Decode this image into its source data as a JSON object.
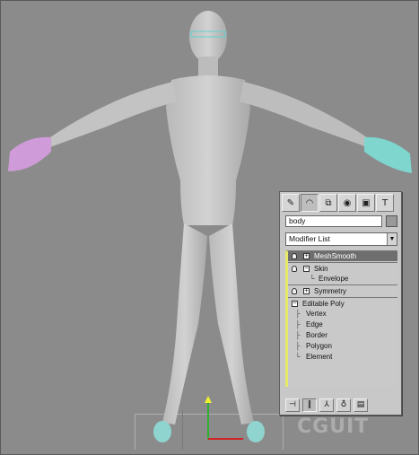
{
  "panel": {
    "tabs": [
      {
        "name": "create-tab",
        "glyph": "✎"
      },
      {
        "name": "modify-tab",
        "glyph": "◠"
      },
      {
        "name": "hierarchy-tab",
        "glyph": "⧉"
      },
      {
        "name": "motion-tab",
        "glyph": "◉"
      },
      {
        "name": "display-tab",
        "glyph": "▣"
      },
      {
        "name": "utilities-tab",
        "glyph": "T"
      }
    ],
    "object_name": "body",
    "modifier_list_label": "Modifier List",
    "stack": {
      "meshsmooth": "MeshSmooth",
      "skin": "Skin",
      "envelope": "Envelope",
      "symmetry": "Symmetry",
      "editable_poly": "Editable Poly",
      "sub_objects": [
        "Vertex",
        "Edge",
        "Border",
        "Polygon",
        "Element"
      ]
    },
    "toolbar": {
      "pin_glyph": "⊣",
      "show_end_glyph": "‖",
      "make_unique_glyph": "⅄",
      "remove_glyph": "♁",
      "configure_glyph": "▤"
    },
    "colors": {
      "panel_bg": "#c8c8c8",
      "selected_row": "#6e6e6e",
      "stack_accent": "#e8e86a",
      "viewport_bg": "#8b8b8b"
    }
  },
  "watermark": "CGUIT"
}
